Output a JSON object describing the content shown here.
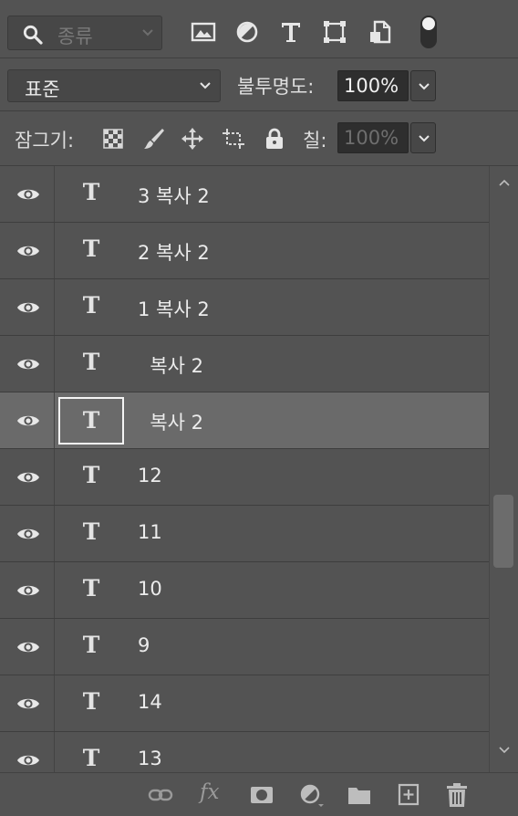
{
  "filter": {
    "label": "종류"
  },
  "blend": {
    "mode": "표준",
    "opacity_label": "불투명도:",
    "opacity": "100%"
  },
  "lock": {
    "label": "잠그기:",
    "fill_label": "칠:",
    "fill": "100%"
  },
  "layers": [
    {
      "name": "3 복사 2"
    },
    {
      "name": "2 복사 2"
    },
    {
      "name": "1 복사 2"
    },
    {
      "name": "  복사 2"
    },
    {
      "name": "  복사 2"
    },
    {
      "name": "12"
    },
    {
      "name": "11"
    },
    {
      "name": "10"
    },
    {
      "name": "9"
    },
    {
      "name": "14"
    },
    {
      "name": "13"
    }
  ],
  "layer_type_glyph": "T",
  "selected_layer_index": 4,
  "colors": {
    "panel": "#535353",
    "selected_row": "#6a6a6a",
    "input_bg": "#2e2e2e"
  },
  "icons": [
    "search-icon",
    "image-filter-icon",
    "adjustment-filter-icon",
    "type-filter-icon",
    "shape-filter-icon",
    "smart-object-filter-icon",
    "filter-toggle",
    "lock-pixels-icon",
    "lock-paint-icon",
    "lock-position-icon",
    "lock-artboard-icon",
    "lock-all-icon",
    "eye-icon",
    "link-icon",
    "fx-icon",
    "mask-icon",
    "adjustment-layer-icon",
    "group-folder-icon",
    "new-layer-icon",
    "trash-icon"
  ]
}
